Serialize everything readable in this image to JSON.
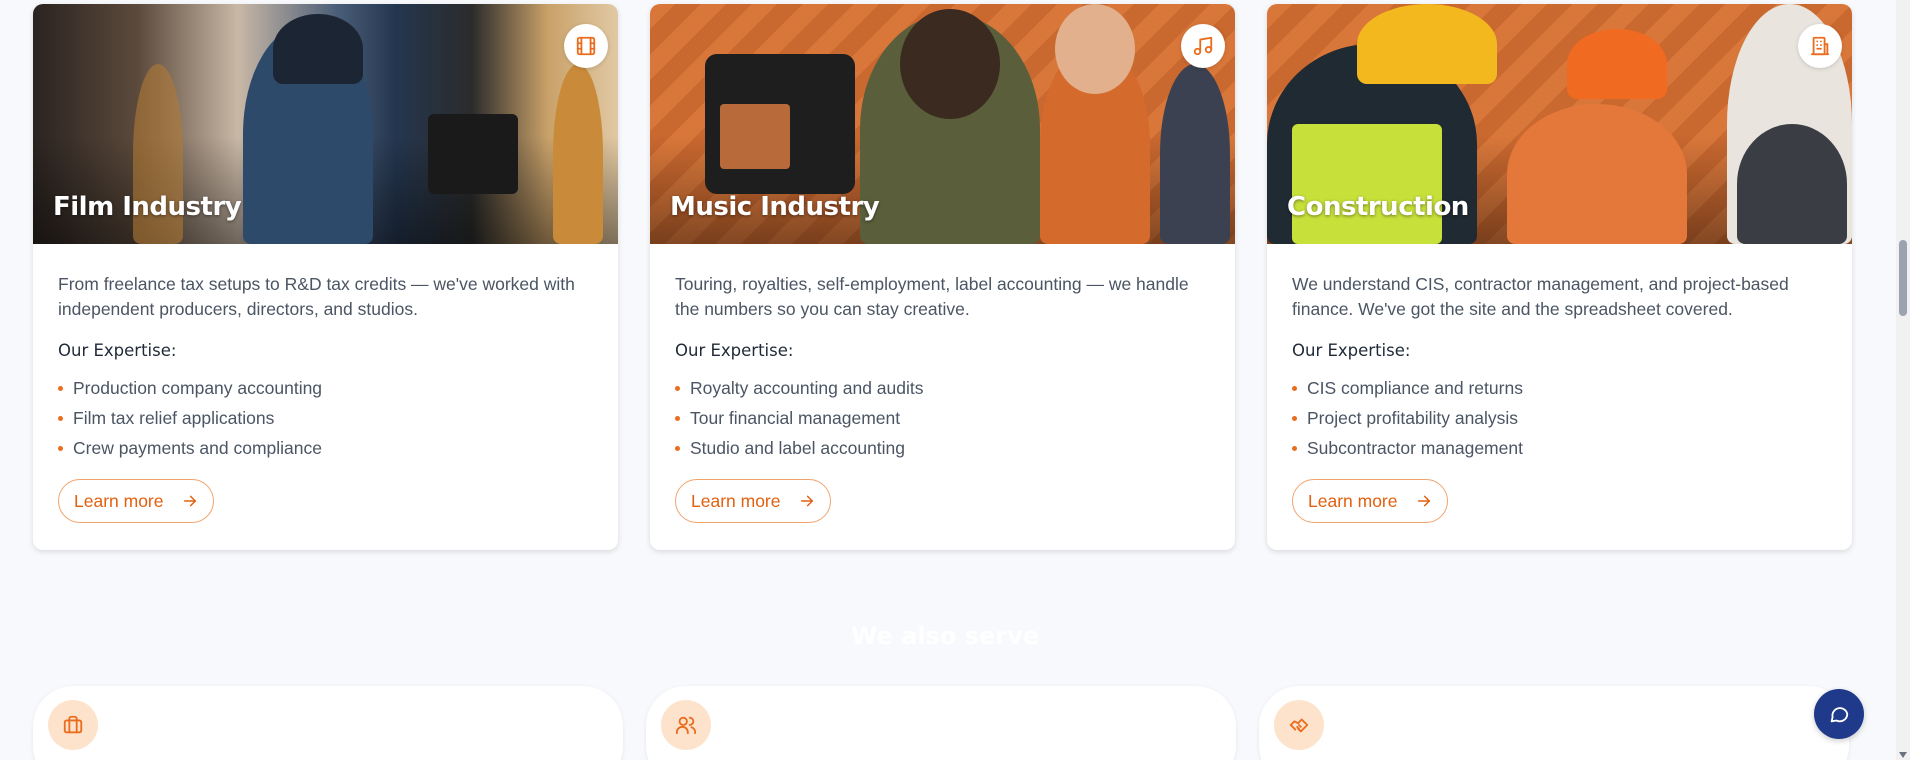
{
  "cards": [
    {
      "title": "Film Industry",
      "icon": "film-icon",
      "description": "From freelance tax setups to R&D tax credits — we've worked with independent producers, directors, and studios.",
      "expertise_title": "Our Expertise:",
      "items": [
        "Production company accounting",
        "Film tax relief applications",
        "Crew payments and compliance"
      ],
      "cta": "Learn more"
    },
    {
      "title": "Music Industry",
      "icon": "music-note-icon",
      "description": "Touring, royalties, self-employment, label accounting — we handle the numbers so you can stay creative.",
      "expertise_title": "Our Expertise:",
      "items": [
        "Royalty accounting and audits",
        "Tour financial management",
        "Studio and label accounting"
      ],
      "cta": "Learn more"
    },
    {
      "title": "Construction",
      "icon": "building-icon",
      "description": "We understand CIS, contractor management, and project-based finance. We've got the site and the spreadsheet covered.",
      "expertise_title": "Our Expertise:",
      "items": [
        "CIS compliance and returns",
        "Project profitability analysis",
        "Subcontractor management"
      ],
      "cta": "Learn more"
    }
  ],
  "also_serve": {
    "heading": "We also serve",
    "items": [
      {
        "icon": "briefcase-icon"
      },
      {
        "icon": "users-icon"
      },
      {
        "icon": "handshake-icon"
      }
    ]
  },
  "colors": {
    "accent": "#ea6d1f",
    "chat_button": "#1f3a8a"
  }
}
